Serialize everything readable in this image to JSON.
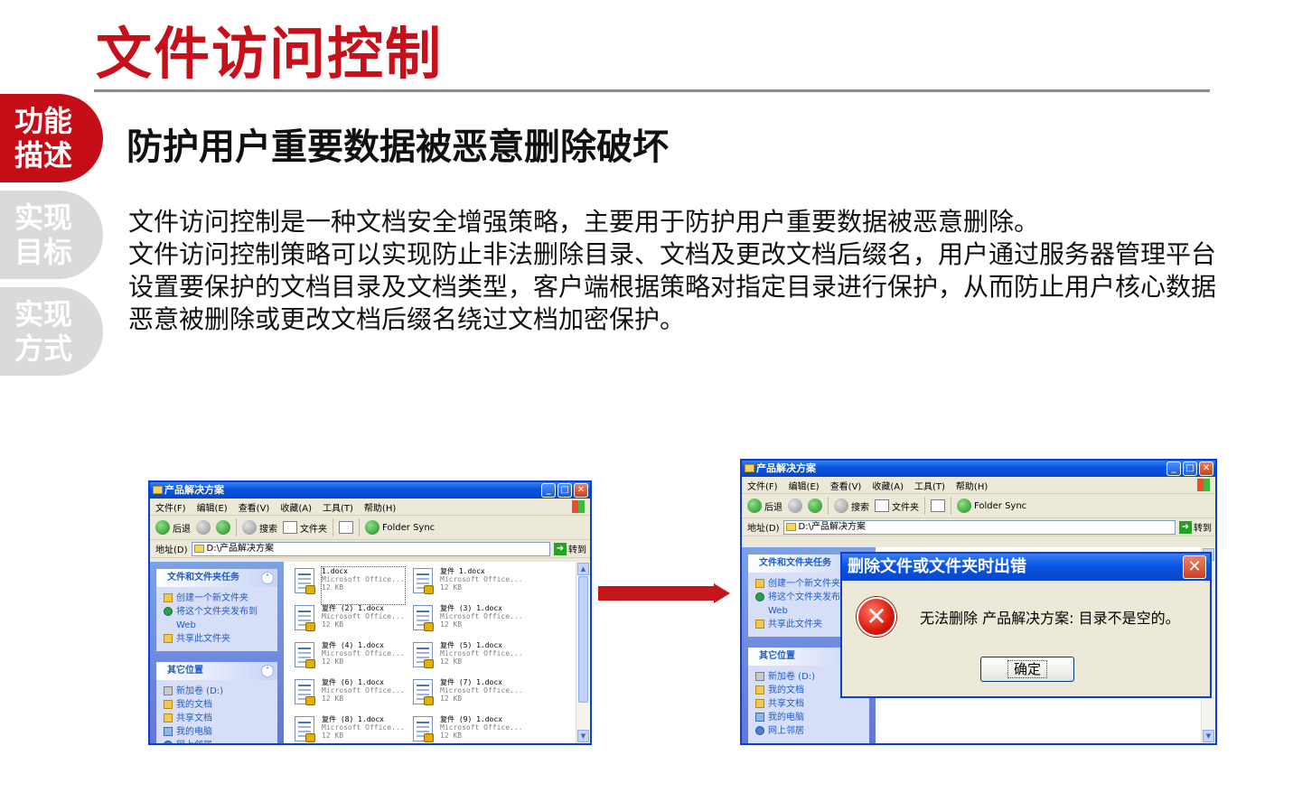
{
  "page": {
    "title": "文件访问控制",
    "subtitle": "防护用户重要数据被恶意删除破坏",
    "paragraphs": [
      "文件访问控制是一种文档安全增强策略，主要用于防护用户重要数据被恶意删除。",
      "文件访问控制策略可以实现防止非法删除目录、文档及更改文档后缀名，用户通过服务器管理平台设置要保护的文档目录及文档类型，客户端根据策略对指定目录进行保护，从而防止用户核心数据恶意被删除或更改文档后缀名绕过文档加密保护。"
    ],
    "accent_color": "#c8101b"
  },
  "side_tabs": [
    {
      "line1": "功能",
      "line2": "描述",
      "active": true
    },
    {
      "line1": "实现",
      "line2": "目标",
      "active": false
    },
    {
      "line1": "实现",
      "line2": "方式",
      "active": false
    }
  ],
  "explorer": {
    "window_title": "产品解决方案",
    "menu": [
      "文件(F)",
      "编辑(E)",
      "查看(V)",
      "收藏(A)",
      "工具(T)",
      "帮助(H)"
    ],
    "toolbar": {
      "back": "后退",
      "search": "搜索",
      "folders": "文件夹",
      "folder_sync": "Folder Sync"
    },
    "address_label": "地址(D)",
    "address_value": "D:\\产品解决方案",
    "go_label": "转到",
    "file_tasks_header": "文件和文件夹任务",
    "file_tasks": [
      "创建一个新文件夹",
      "将这个文件夹发布到 Web",
      "共享此文件夹"
    ],
    "other_places_header": "其它位置",
    "other_places": [
      "新加卷 (D:)",
      "我的文档",
      "共享文档",
      "我的电脑",
      "网上邻居"
    ],
    "files": [
      {
        "name": "1.docx",
        "type": "Microsoft Office...",
        "size": "12 KB"
      },
      {
        "name": "复件 1.docx",
        "type": "Microsoft Office...",
        "size": "12 KB"
      },
      {
        "name": "复件 (2) 1.docx",
        "type": "Microsoft Office...",
        "size": "12 KB"
      },
      {
        "name": "复件 (3) 1.docx",
        "type": "Microsoft Office...",
        "size": "12 KB"
      },
      {
        "name": "复件 (4) 1.docx",
        "type": "Microsoft Office...",
        "size": "12 KB"
      },
      {
        "name": "复件 (5) 1.docx",
        "type": "Microsoft Office...",
        "size": "12 KB"
      },
      {
        "name": "复件 (6) 1.docx",
        "type": "Microsoft Office...",
        "size": "12 KB"
      },
      {
        "name": "复件 (7) 1.docx",
        "type": "Microsoft Office...",
        "size": "12 KB"
      },
      {
        "name": "复件 (8) 1.docx",
        "type": "Microsoft Office...",
        "size": "12 KB"
      },
      {
        "name": "复件 (9) 1.docx",
        "type": "Microsoft Office...",
        "size": "12 KB"
      }
    ]
  },
  "error_dialog": {
    "title": "删除文件或文件夹时出错",
    "message": "无法删除 产品解决方案: 目录不是空的。",
    "ok_label": "确定",
    "close_glyph": "✕",
    "icon_glyph": "✕"
  },
  "window_controls": {
    "min": "_",
    "max": "□",
    "close": "✕"
  }
}
